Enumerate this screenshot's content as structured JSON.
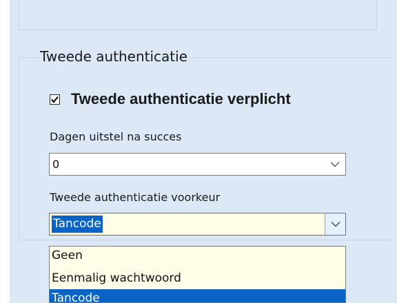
{
  "group": {
    "title": "Tweede authenticatie",
    "checkbox": {
      "label": "Tweede authenticatie verplicht",
      "checked": true
    },
    "delay_field": {
      "label": "Dagen uitstel na succes",
      "value": "0"
    },
    "preference_field": {
      "label": "Tweede authenticatie voorkeur",
      "value": "Tancode",
      "options": [
        "Geen",
        "Eenmalig wachtwoord",
        "Tancode"
      ],
      "selected_index": 2
    }
  },
  "colors": {
    "panel_bg": "#dde8f7",
    "highlight": "#0b64c3",
    "dropdown_bg": "#fffde7"
  }
}
